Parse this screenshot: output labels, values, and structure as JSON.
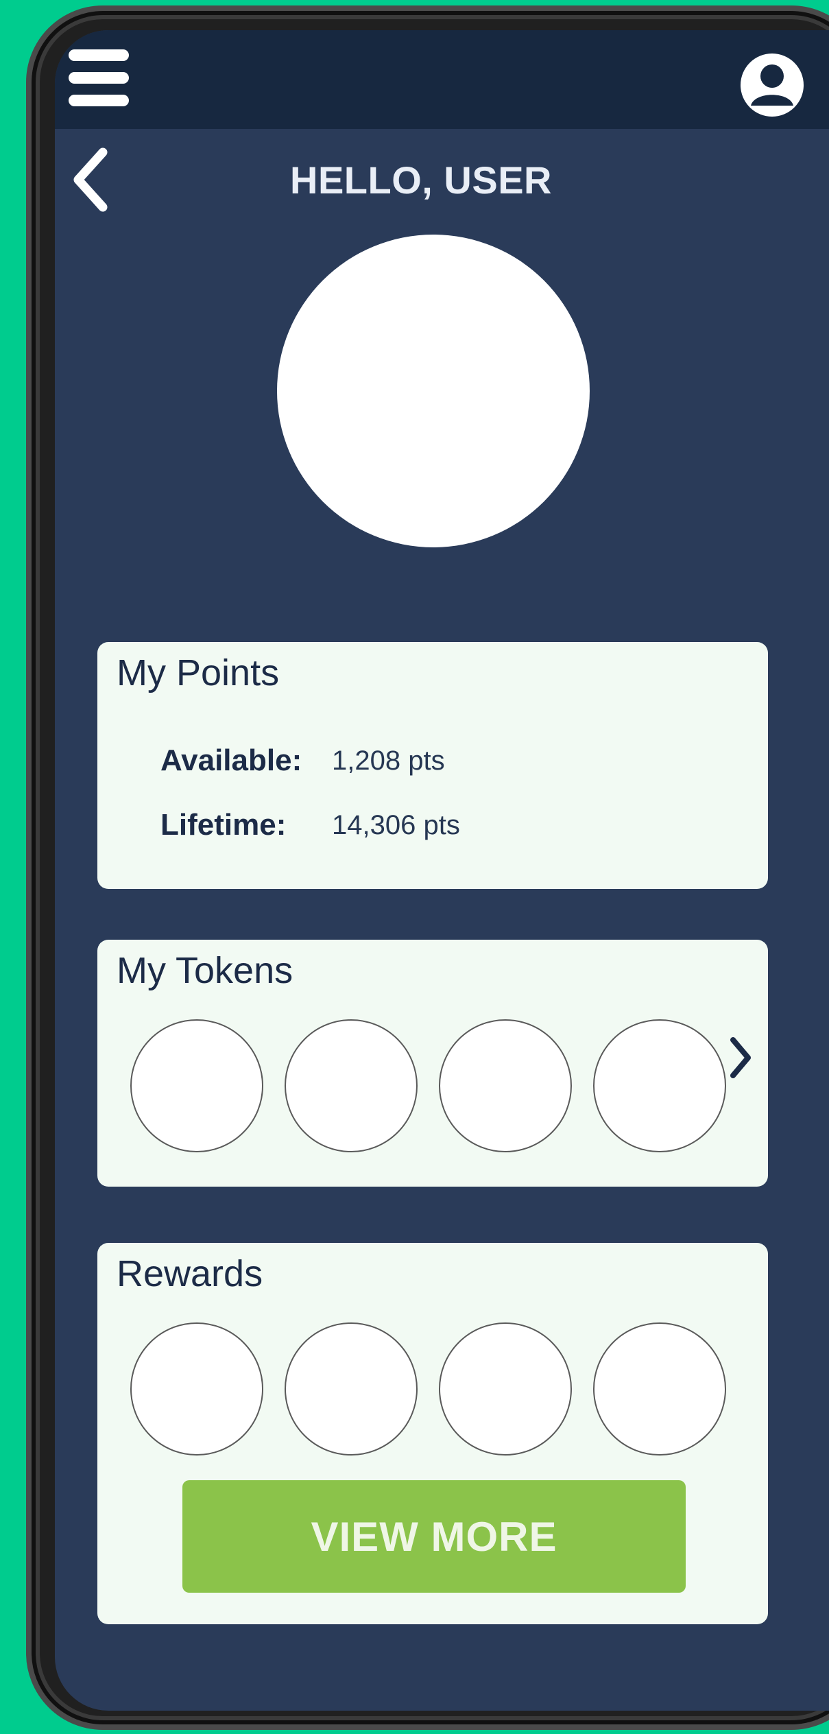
{
  "header": {
    "title": "HELLO, USER"
  },
  "icons": {
    "menu": "hamburger-menu-icon",
    "account": "account-circle-icon",
    "back": "chevron-left-icon",
    "next": "chevron-right-icon"
  },
  "points_card": {
    "title": "My Points",
    "rows": [
      {
        "label": "Available:",
        "value": "1,208 pts"
      },
      {
        "label": "Lifetime:",
        "value": "14,306 pts"
      }
    ]
  },
  "tokens_card": {
    "title": "My Tokens"
  },
  "rewards_card": {
    "title": "Rewards",
    "button_label": "VIEW MORE"
  },
  "colors": {
    "background": "#00cc8e",
    "screen": "#2a3b59",
    "topbar": "#172840",
    "card": "#f2faf3",
    "text_dark": "#1c2b47",
    "button": "#8bc34a"
  }
}
